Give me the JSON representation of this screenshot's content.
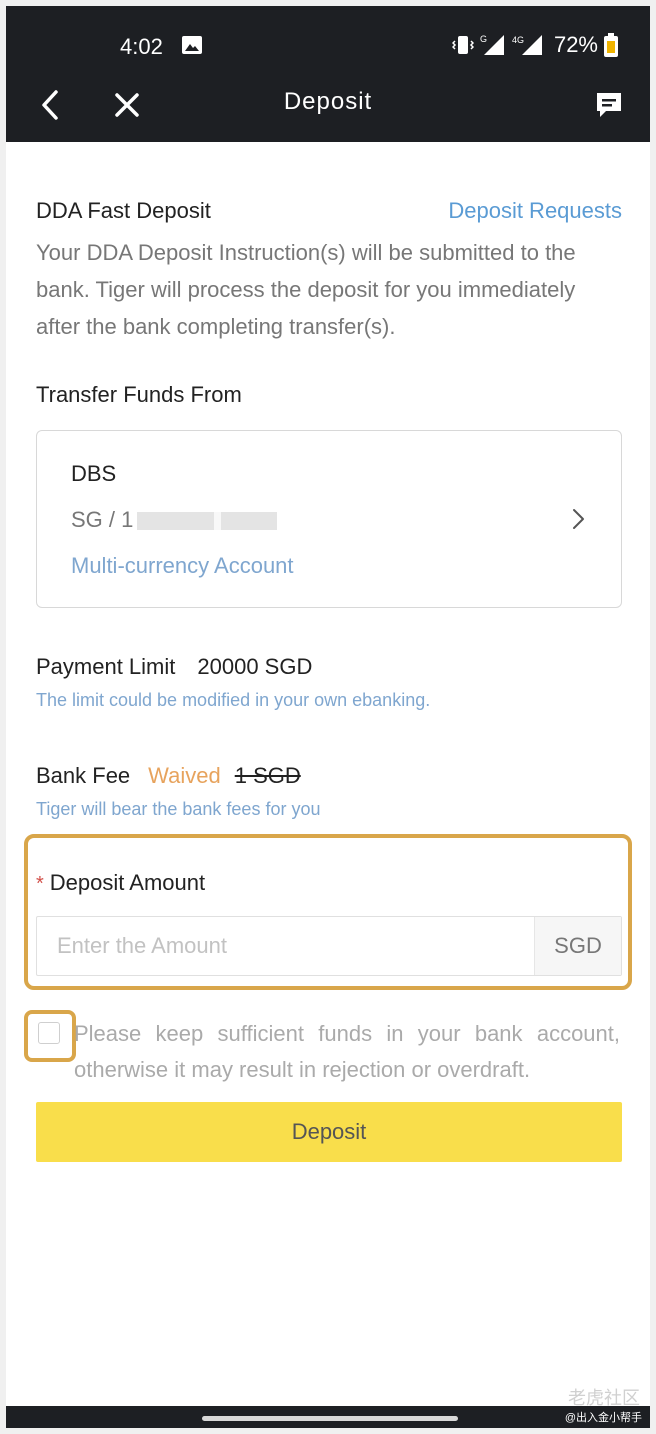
{
  "status_bar": {
    "time": "4:02",
    "battery": "72%"
  },
  "nav": {
    "title": "Deposit"
  },
  "dda": {
    "title": "DDA Fast Deposit",
    "requests_link": "Deposit Requests",
    "description": "Your DDA Deposit Instruction(s) will be submitted to the bank. Tiger will process the deposit for you immediately after the bank completing transfer(s)."
  },
  "transfer": {
    "label": "Transfer Funds From",
    "bank_name": "DBS",
    "account_prefix": "SG / 1",
    "account_type": "Multi-currency Account"
  },
  "payment_limit": {
    "label": "Payment Limit",
    "value": "20000 SGD",
    "note": "The limit could be modified in your own ebanking."
  },
  "bank_fee": {
    "label": "Bank Fee",
    "status": "Waived",
    "original": "1 SGD",
    "note": "Tiger will bear the bank fees for you"
  },
  "deposit_amount": {
    "required_mark": "*",
    "label": "Deposit Amount",
    "placeholder": "Enter the Amount",
    "value": "",
    "currency": "SGD"
  },
  "agreement": {
    "checked": false,
    "text": "Please keep sufficient funds in your bank account, otherwise it may result in rejection or overdraft."
  },
  "submit": {
    "label": "Deposit"
  },
  "footer": {
    "watermark": "老虎社区",
    "credit": "@出入金小帮手"
  },
  "colors": {
    "topbar": "#1d1f23",
    "link": "#5a9bd4",
    "waived": "#e7a35d",
    "button": "#f9de4b",
    "highlight": "#d9a64a"
  }
}
